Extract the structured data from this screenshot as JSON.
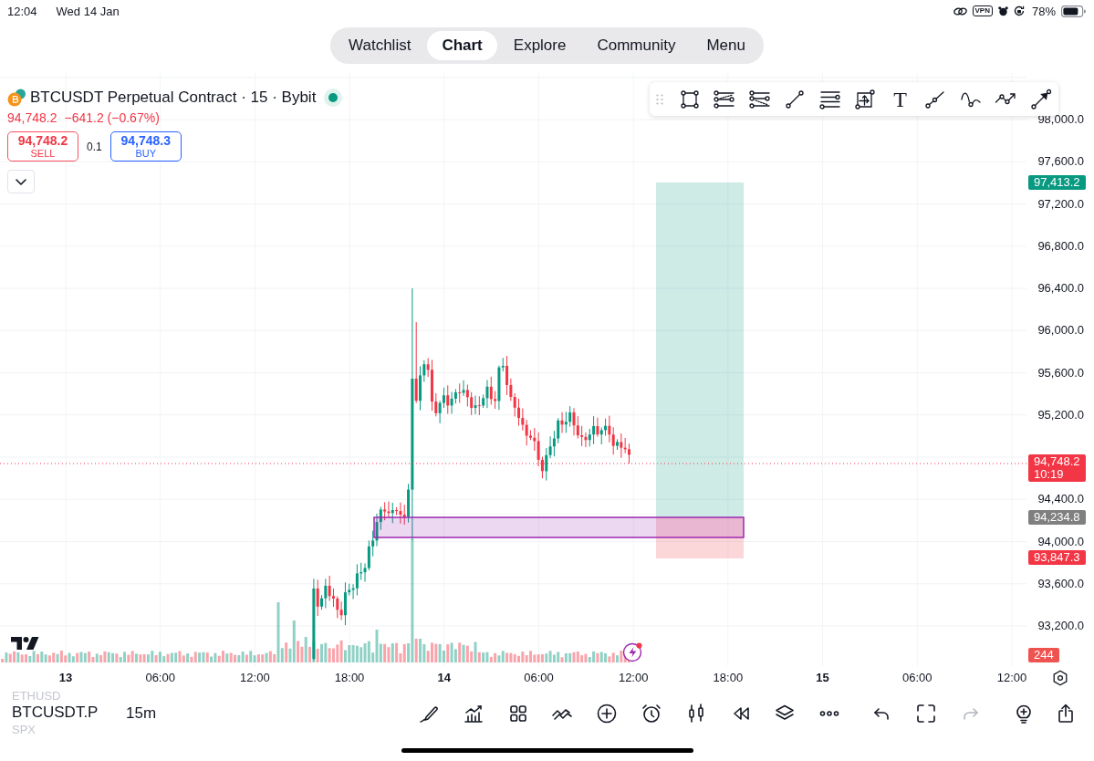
{
  "status_bar": {
    "time": "12:04",
    "date": "Wed 14 Jan",
    "vpn": "VPN",
    "battery": "78%"
  },
  "nav_tabs": [
    {
      "label": "Watchlist",
      "selected": false
    },
    {
      "label": "Chart",
      "selected": true
    },
    {
      "label": "Explore",
      "selected": false
    },
    {
      "label": "Community",
      "selected": false
    },
    {
      "label": "Menu",
      "selected": false
    }
  ],
  "legend": {
    "title": "BTCUSDT Perpetual Contract · 15 · Bybit",
    "last_price": "94,748.2",
    "change": "−641.2 (−0.67%)",
    "sell": {
      "price": "94,748.2",
      "label": "SELL"
    },
    "spread": "0.1",
    "buy": {
      "price": "94,748.3",
      "label": "BUY"
    }
  },
  "drawing_toolbar": {
    "text_tool": "T"
  },
  "price_axis": {
    "labels": [
      "98,000.0",
      "97,600.0",
      "97,200.0",
      "96,800.0",
      "96,400.0",
      "96,000.0",
      "95,600.0",
      "95,200.0",
      "94,400.0",
      "94,000.0",
      "93,600.0",
      "93,200.0"
    ],
    "tags": [
      {
        "kind": "target",
        "color": "#089981",
        "lines": [
          "97,413.2"
        ]
      },
      {
        "kind": "last",
        "color": "#f23645",
        "lines": [
          "94,748.2",
          "10:19"
        ]
      },
      {
        "kind": "entry",
        "color": "#808080",
        "lines": [
          "94,234.8"
        ]
      },
      {
        "kind": "stop",
        "color": "#f23645",
        "lines": [
          "93,847.3"
        ]
      },
      {
        "kind": "volume",
        "color": "#ef5350",
        "lines": [
          "244"
        ]
      }
    ]
  },
  "time_axis": {
    "labels": [
      {
        "text": "13",
        "kind": "day"
      },
      {
        "text": "06:00",
        "kind": "time"
      },
      {
        "text": "12:00",
        "kind": "time"
      },
      {
        "text": "18:00",
        "kind": "time"
      },
      {
        "text": "14",
        "kind": "day"
      },
      {
        "text": "06:00",
        "kind": "time"
      },
      {
        "text": "12:00",
        "kind": "time"
      },
      {
        "text": "18:00",
        "kind": "time"
      },
      {
        "text": "15",
        "kind": "day"
      },
      {
        "text": "06:00",
        "kind": "time"
      },
      {
        "text": "12:00",
        "kind": "time"
      }
    ]
  },
  "bottom_bar": {
    "symbols": [
      {
        "label": "ETHUSD",
        "selected": false
      },
      {
        "label": "BTCUSDT.P",
        "selected": true
      },
      {
        "label": "SPX",
        "selected": false
      }
    ],
    "interval": "15m",
    "redo_disabled": true
  }
}
